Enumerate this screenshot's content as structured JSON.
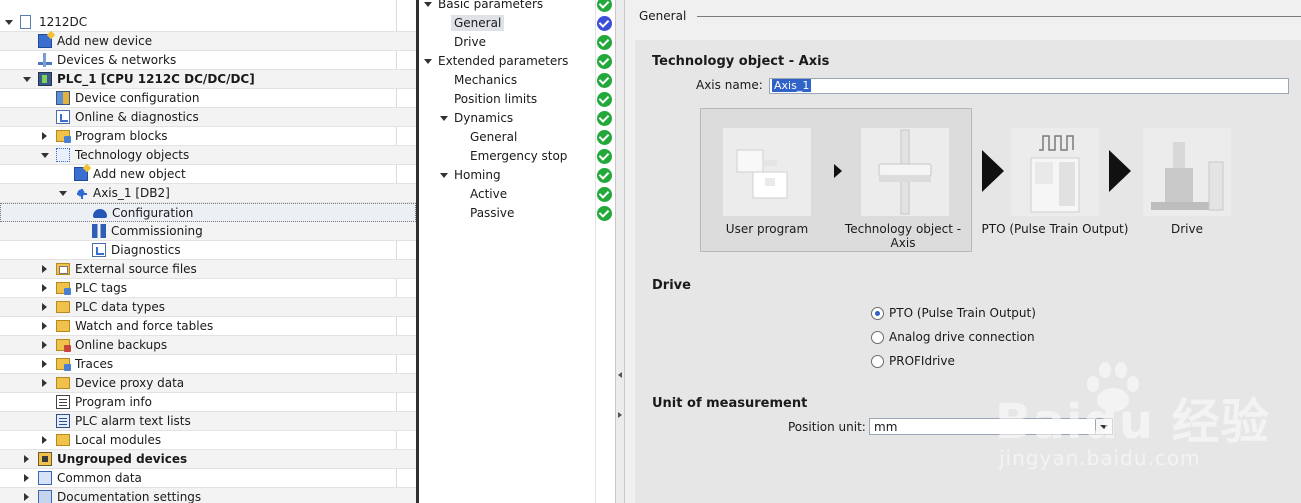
{
  "project_tree": {
    "items": [
      {
        "label": "1212DC",
        "indent": 0,
        "expanded": true,
        "icon": "document-icon",
        "bold": false
      },
      {
        "label": "Add new device",
        "indent": 1,
        "icon": "add-device-icon"
      },
      {
        "label": "Devices & networks",
        "indent": 1,
        "icon": "network-icon"
      },
      {
        "label": "PLC_1 [CPU 1212C DC/DC/DC]",
        "indent": 1,
        "expanded": true,
        "icon": "plc-icon",
        "bold": true
      },
      {
        "label": "Device configuration",
        "indent": 2,
        "icon": "device-config-icon"
      },
      {
        "label": "Online & diagnostics",
        "indent": 2,
        "icon": "online-diagnostics-icon"
      },
      {
        "label": "Program blocks",
        "indent": 2,
        "collapsed": true,
        "icon": "folder-icon"
      },
      {
        "label": "Technology objects",
        "indent": 2,
        "expanded": true,
        "icon": "technology-folder-icon"
      },
      {
        "label": "Add new object",
        "indent": 3,
        "icon": "add-object-icon"
      },
      {
        "label": "Axis_1 [DB2]",
        "indent": 3,
        "expanded": true,
        "icon": "axis-icon"
      },
      {
        "label": "Configuration",
        "indent": 4,
        "icon": "configuration-icon",
        "selected": true
      },
      {
        "label": "Commissioning",
        "indent": 4,
        "icon": "commissioning-icon"
      },
      {
        "label": "Diagnostics",
        "indent": 4,
        "icon": "diagnostics-icon"
      },
      {
        "label": "External source files",
        "indent": 2,
        "collapsed": true,
        "icon": "external-source-icon"
      },
      {
        "label": "PLC tags",
        "indent": 2,
        "collapsed": true,
        "icon": "folder-icon"
      },
      {
        "label": "PLC data types",
        "indent": 2,
        "collapsed": true,
        "icon": "folder-icon"
      },
      {
        "label": "Watch and force tables",
        "indent": 2,
        "collapsed": true,
        "icon": "folder-icon"
      },
      {
        "label": "Online backups",
        "indent": 2,
        "collapsed": true,
        "icon": "folder-icon"
      },
      {
        "label": "Traces",
        "indent": 2,
        "collapsed": true,
        "icon": "folder-icon"
      },
      {
        "label": "Device proxy data",
        "indent": 2,
        "collapsed": true,
        "icon": "folder-icon"
      },
      {
        "label": "Program info",
        "indent": 2,
        "icon": "program-info-icon"
      },
      {
        "label": "PLC alarm text lists",
        "indent": 2,
        "icon": "alarm-text-icon"
      },
      {
        "label": "Local modules",
        "indent": 2,
        "collapsed": true,
        "icon": "folder-icon"
      },
      {
        "label": "Ungrouped devices",
        "indent": 1,
        "collapsed": true,
        "icon": "ungrouped-devices-icon",
        "bold": true
      },
      {
        "label": "Common data",
        "indent": 1,
        "collapsed": true,
        "icon": "common-data-icon"
      },
      {
        "label": "Documentation settings",
        "indent": 1,
        "collapsed": true,
        "icon": "documentation-icon"
      }
    ]
  },
  "param_nav": {
    "items": [
      {
        "label": "Basic parameters",
        "indent": 0,
        "expanded": true,
        "status": "ok"
      },
      {
        "label": "General",
        "indent": 1,
        "status": "ok-blue",
        "selected": true
      },
      {
        "label": "Drive",
        "indent": 1,
        "status": "ok"
      },
      {
        "label": "Extended parameters",
        "indent": 0,
        "expanded": true,
        "status": "ok"
      },
      {
        "label": "Mechanics",
        "indent": 1,
        "status": "ok"
      },
      {
        "label": "Position limits",
        "indent": 1,
        "status": "ok"
      },
      {
        "label": "Dynamics",
        "indent": 1,
        "expanded": true,
        "status": "ok"
      },
      {
        "label": "General",
        "indent": 2,
        "status": "ok"
      },
      {
        "label": "Emergency stop",
        "indent": 2,
        "status": "ok"
      },
      {
        "label": "Homing",
        "indent": 1,
        "expanded": true,
        "status": "ok"
      },
      {
        "label": "Active",
        "indent": 2,
        "status": "ok"
      },
      {
        "label": "Passive",
        "indent": 2,
        "status": "ok"
      }
    ]
  },
  "general": {
    "heading": "General",
    "section_tech": "Technology object - Axis",
    "axis_name_label": "Axis name:",
    "axis_name_value": "Axis_1",
    "diagram": {
      "user_program": "User program",
      "tech_object": "Technology object - Axis",
      "pto": "PTO (Pulse Train Output)",
      "drive": "Drive"
    },
    "section_drive": "Drive",
    "drive_options": [
      {
        "label": "PTO (Pulse Train Output)",
        "selected": true
      },
      {
        "label": "Analog drive connection",
        "selected": false
      },
      {
        "label": "PROFIdrive",
        "selected": false
      }
    ],
    "section_unit": "Unit of measurement",
    "position_unit_label": "Position unit:",
    "position_unit_value": "mm"
  },
  "watermark": {
    "brand": "Baidu 经验",
    "url": "jingyan.baidu.com"
  },
  "colors": {
    "status_ok": "#23a83a",
    "status_selected": "#3b4ed8",
    "selection_blue": "#2f63c8"
  }
}
